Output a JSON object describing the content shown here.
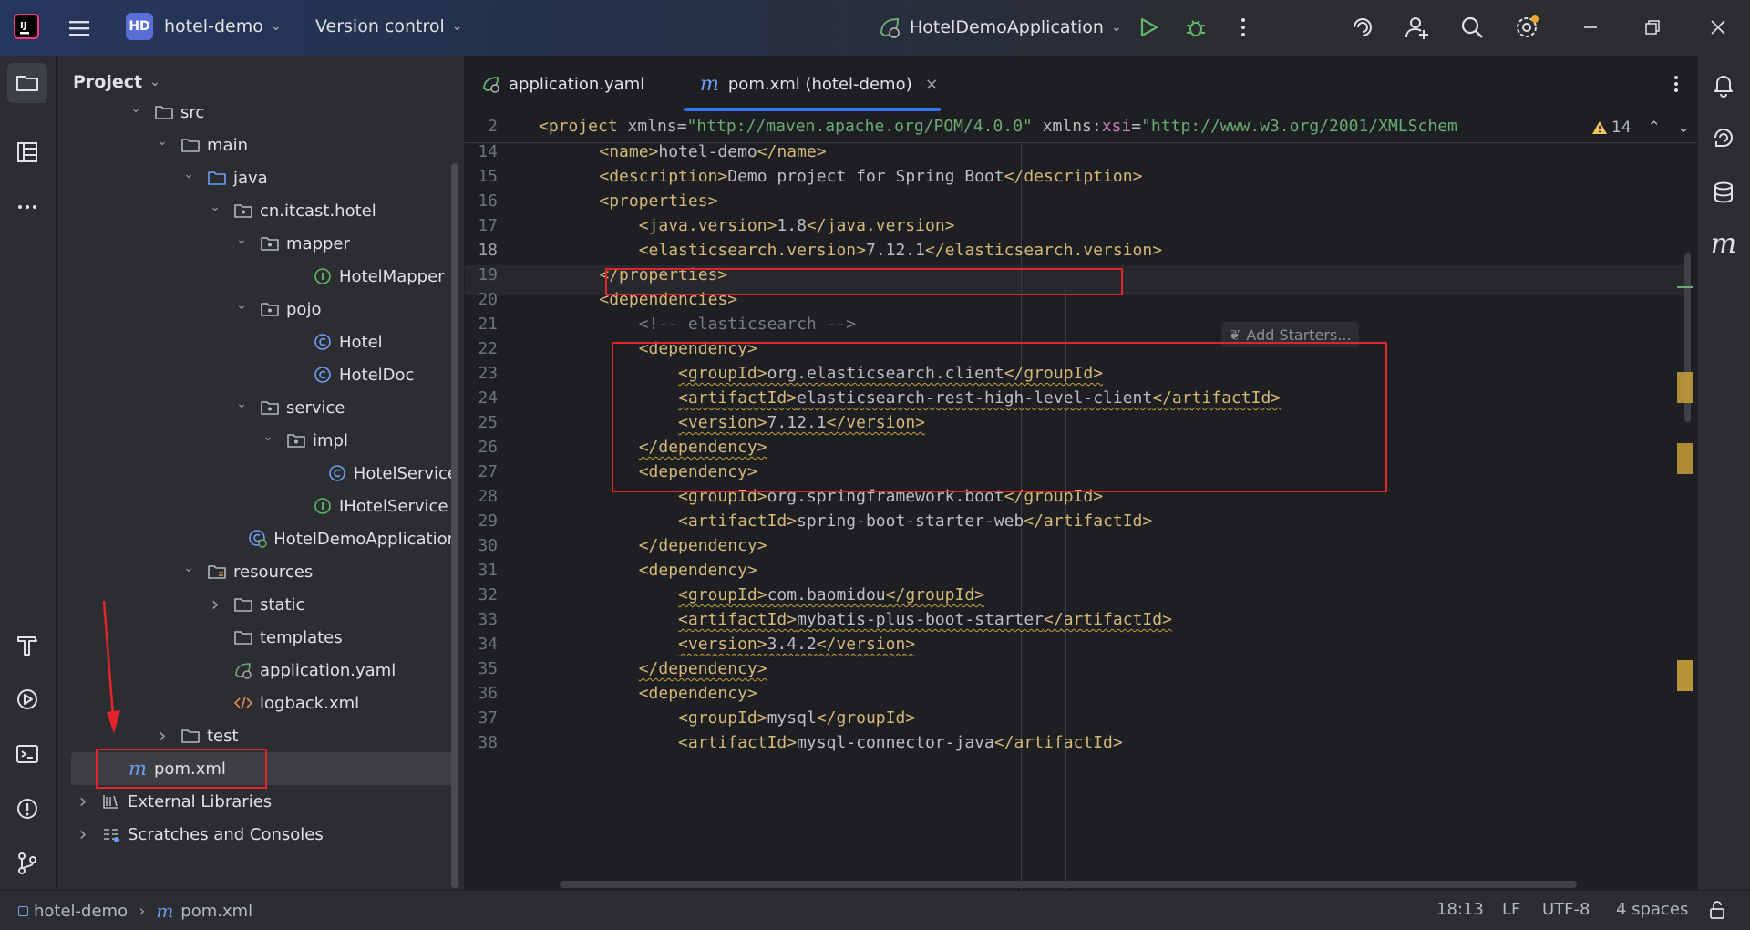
{
  "titlebar": {
    "project_badge": "HD",
    "project_name": "hotel-demo",
    "vcs_label": "Version control",
    "run_config": "HotelDemoApplication"
  },
  "project_panel": {
    "title": "Project",
    "tree": [
      {
        "label": "src",
        "type": "folder",
        "chev": "v"
      },
      {
        "label": "main",
        "type": "folder",
        "chev": "v"
      },
      {
        "label": "java",
        "type": "folder-src",
        "chev": "v"
      },
      {
        "label": "cn.itcast.hotel",
        "type": "package",
        "chev": "v"
      },
      {
        "label": "mapper",
        "type": "package",
        "chev": "v"
      },
      {
        "label": "HotelMapper",
        "type": "interface",
        "chev": ""
      },
      {
        "label": "pojo",
        "type": "package",
        "chev": "v"
      },
      {
        "label": "Hotel",
        "type": "class",
        "chev": ""
      },
      {
        "label": "HotelDoc",
        "type": "class",
        "chev": ""
      },
      {
        "label": "service",
        "type": "package",
        "chev": "v"
      },
      {
        "label": "impl",
        "type": "package",
        "chev": "v"
      },
      {
        "label": "HotelService",
        "type": "class",
        "chev": ""
      },
      {
        "label": "IHotelService",
        "type": "interface",
        "chev": ""
      },
      {
        "label": "HotelDemoApplication",
        "type": "spring-class",
        "chev": ""
      },
      {
        "label": "resources",
        "type": "folder-res",
        "chev": "v"
      },
      {
        "label": "static",
        "type": "folder",
        "chev": ">"
      },
      {
        "label": "templates",
        "type": "folder",
        "chev": ""
      },
      {
        "label": "application.yaml",
        "type": "yaml",
        "chev": ""
      },
      {
        "label": "logback.xml",
        "type": "xml",
        "chev": ""
      },
      {
        "label": "test",
        "type": "folder",
        "chev": ">"
      },
      {
        "label": "pom.xml",
        "type": "maven",
        "chev": ""
      },
      {
        "label": "External Libraries",
        "type": "libs",
        "chev": ">"
      },
      {
        "label": "Scratches and Consoles",
        "type": "scratch",
        "chev": ">"
      }
    ]
  },
  "editor": {
    "tabs": [
      {
        "label": "application.yaml",
        "active": false
      },
      {
        "label": "pom.xml (hotel-demo)",
        "active": true
      }
    ],
    "warning_count": "14",
    "add_starters": "Add Starters...",
    "lines": [
      {
        "n": "2",
        "tokens": [
          [
            "tag",
            "<project "
          ],
          [
            "attr",
            "xmlns="
          ],
          [
            "str",
            "\"http://maven.apache.org/POM/4.0.0\""
          ],
          [
            "attr",
            " xmlns:"
          ],
          [
            "ns",
            "xsi"
          ],
          [
            "attr",
            "="
          ],
          [
            "str",
            "\"http://www.w3.org/2001/XMLSchem"
          ]
        ]
      },
      {
        "n": "14",
        "tokens": [
          [
            "txt",
            "    "
          ],
          [
            "tag",
            "<name>"
          ],
          [
            "txt",
            "hotel-demo"
          ],
          [
            "tag",
            "</name>"
          ]
        ]
      },
      {
        "n": "15",
        "tokens": [
          [
            "txt",
            "    "
          ],
          [
            "tag",
            "<description>"
          ],
          [
            "txt",
            "Demo project for Spring Boot"
          ],
          [
            "tag",
            "</description>"
          ]
        ]
      },
      {
        "n": "16",
        "tokens": [
          [
            "txt",
            "    "
          ],
          [
            "tag",
            "<properties>"
          ]
        ]
      },
      {
        "n": "17",
        "tokens": [
          [
            "txt",
            "        "
          ],
          [
            "tag",
            "<java.version>"
          ],
          [
            "txt",
            "1.8"
          ],
          [
            "tag",
            "</java.version>"
          ]
        ]
      },
      {
        "n": "18",
        "tokens": [
          [
            "txt",
            "        "
          ],
          [
            "tag",
            "<elasticsearch.version>"
          ],
          [
            "txt",
            "7.12.1"
          ],
          [
            "tag",
            "</elasticsearch.version>"
          ]
        ]
      },
      {
        "n": "19",
        "tokens": [
          [
            "txt",
            "    "
          ],
          [
            "tag",
            "</properties>"
          ]
        ]
      },
      {
        "n": "20",
        "tokens": [
          [
            "txt",
            "    "
          ],
          [
            "tag",
            "<dependencies>"
          ]
        ]
      },
      {
        "n": "21",
        "tokens": [
          [
            "txt",
            "        "
          ],
          [
            "cmt",
            "<!-- elasticsearch -->"
          ]
        ]
      },
      {
        "n": "22",
        "tokens": [
          [
            "txt",
            "        "
          ],
          [
            "tag",
            "<dependency>"
          ]
        ]
      },
      {
        "n": "23",
        "tokens": [
          [
            "txt",
            "            "
          ],
          [
            "tag",
            "<groupId>"
          ],
          [
            "txt",
            "org.elasticsearch.client"
          ],
          [
            "tag",
            "</groupId>"
          ]
        ]
      },
      {
        "n": "24",
        "tokens": [
          [
            "txt",
            "            "
          ],
          [
            "tag",
            "<artifactId>"
          ],
          [
            "txt",
            "elasticsearch-rest-high-level-client"
          ],
          [
            "tag",
            "</artifactId>"
          ]
        ]
      },
      {
        "n": "25",
        "tokens": [
          [
            "txt",
            "            "
          ],
          [
            "tag",
            "<version>"
          ],
          [
            "txt",
            "7.12.1"
          ],
          [
            "tag",
            "</version>"
          ]
        ]
      },
      {
        "n": "26",
        "tokens": [
          [
            "txt",
            "        "
          ],
          [
            "tag",
            "</dependency>"
          ]
        ]
      },
      {
        "n": "27",
        "tokens": [
          [
            "txt",
            "        "
          ],
          [
            "tag",
            "<dependency>"
          ]
        ]
      },
      {
        "n": "28",
        "tokens": [
          [
            "txt",
            "            "
          ],
          [
            "tag",
            "<groupId>"
          ],
          [
            "txt",
            "org.springframework.boot"
          ],
          [
            "tag",
            "</groupId>"
          ]
        ]
      },
      {
        "n": "29",
        "tokens": [
          [
            "txt",
            "            "
          ],
          [
            "tag",
            "<artifactId>"
          ],
          [
            "txt",
            "spring-boot-starter-web"
          ],
          [
            "tag",
            "</artifactId>"
          ]
        ]
      },
      {
        "n": "30",
        "tokens": [
          [
            "txt",
            "        "
          ],
          [
            "tag",
            "</dependency>"
          ]
        ]
      },
      {
        "n": "31",
        "tokens": [
          [
            "txt",
            "        "
          ],
          [
            "tag",
            "<dependency>"
          ]
        ]
      },
      {
        "n": "32",
        "tokens": [
          [
            "txt",
            "            "
          ],
          [
            "tag",
            "<groupId>"
          ],
          [
            "txt",
            "com.baomidou"
          ],
          [
            "tag",
            "</groupId>"
          ]
        ]
      },
      {
        "n": "33",
        "tokens": [
          [
            "txt",
            "            "
          ],
          [
            "tag",
            "<artifactId>"
          ],
          [
            "txt",
            "mybatis-plus-boot-starter"
          ],
          [
            "tag",
            "</artifactId>"
          ]
        ]
      },
      {
        "n": "34",
        "tokens": [
          [
            "txt",
            "            "
          ],
          [
            "tag",
            "<version>"
          ],
          [
            "txt",
            "3.4.2"
          ],
          [
            "tag",
            "</version>"
          ]
        ]
      },
      {
        "n": "35",
        "tokens": [
          [
            "txt",
            "        "
          ],
          [
            "tag",
            "</dependency>"
          ]
        ]
      },
      {
        "n": "36",
        "tokens": [
          [
            "txt",
            "        "
          ],
          [
            "tag",
            "<dependency>"
          ]
        ]
      },
      {
        "n": "37",
        "tokens": [
          [
            "txt",
            "            "
          ],
          [
            "tag",
            "<groupId>"
          ],
          [
            "txt",
            "mysql"
          ],
          [
            "tag",
            "</groupId>"
          ]
        ]
      },
      {
        "n": "38",
        "tokens": [
          [
            "txt",
            "            "
          ],
          [
            "tag",
            "<artifactId>"
          ],
          [
            "txt",
            "mysql-connector-java"
          ],
          [
            "tag",
            "</artifactId>"
          ]
        ]
      }
    ]
  },
  "statusbar": {
    "breadcrumb_project": "hotel-demo",
    "breadcrumb_file": "pom.xml",
    "position": "18:13",
    "line_sep": "LF",
    "encoding": "UTF-8",
    "indent": "4 spaces"
  },
  "colors": {
    "accent": "#3574f0",
    "highlight_red": "#e3242b",
    "xml_tag": "#d5b778",
    "string": "#6aab73"
  }
}
